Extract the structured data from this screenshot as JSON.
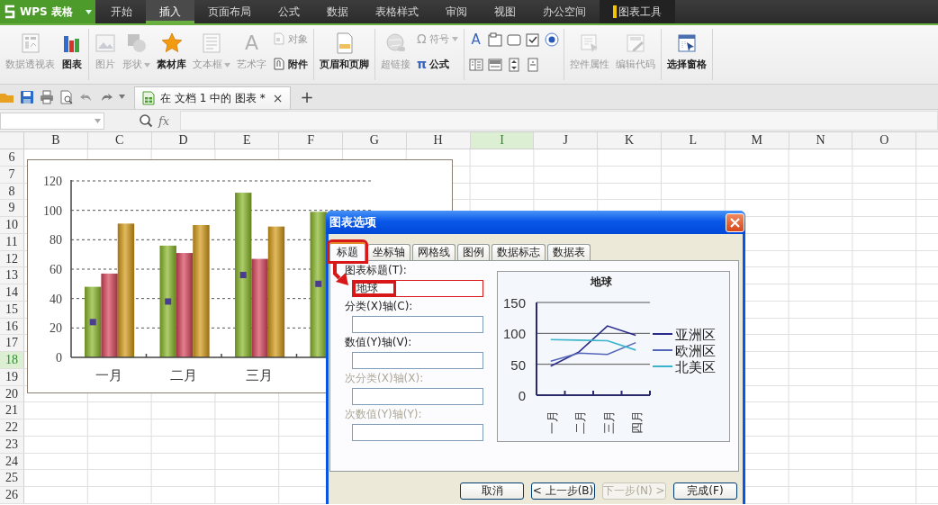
{
  "app_menu": {
    "label": "WPS 表格"
  },
  "menu_tabs": [
    {
      "label": "开始",
      "selected": false,
      "kind": "normal"
    },
    {
      "label": "插入",
      "selected": true,
      "kind": "normal"
    },
    {
      "label": "页面布局",
      "selected": false,
      "kind": "normal"
    },
    {
      "label": "公式",
      "selected": false,
      "kind": "normal"
    },
    {
      "label": "数据",
      "selected": false,
      "kind": "normal"
    },
    {
      "label": "表格样式",
      "selected": false,
      "kind": "normal"
    },
    {
      "label": "审阅",
      "selected": false,
      "kind": "normal"
    },
    {
      "label": "视图",
      "selected": false,
      "kind": "normal"
    },
    {
      "label": "办公空间",
      "selected": false,
      "kind": "normal"
    },
    {
      "label": "图表工具",
      "selected": false,
      "kind": "context"
    }
  ],
  "ribbon": {
    "groups": [
      {
        "items": [
          {
            "kind": "large",
            "label": "数据透视表",
            "disabled": true
          },
          {
            "kind": "large",
            "label": "图表",
            "disabled": false
          }
        ]
      },
      {
        "items": [
          {
            "kind": "large",
            "label": "图片",
            "disabled": true
          },
          {
            "kind": "large",
            "label": "形状",
            "disabled": true,
            "dropdown": true
          },
          {
            "kind": "large",
            "label": "素材库",
            "disabled": false
          },
          {
            "kind": "large",
            "label": "文本框",
            "disabled": true,
            "dropdown": true
          },
          {
            "kind": "large",
            "label": "艺术字",
            "disabled": true,
            "glyph": "A"
          },
          {
            "kind": "stack",
            "items": [
              {
                "label": "对象",
                "disabled": true
              },
              {
                "label": "附件",
                "disabled": false
              }
            ]
          }
        ]
      },
      {
        "items": [
          {
            "kind": "large",
            "label": "页眉和页脚",
            "disabled": false
          }
        ]
      },
      {
        "items": [
          {
            "kind": "large",
            "label": "超链接",
            "disabled": true
          },
          {
            "kind": "stack",
            "items": [
              {
                "label": "符号",
                "disabled": true,
                "glyph": "Ω",
                "dropdown": true
              },
              {
                "label": "公式",
                "disabled": false,
                "glyph": "π"
              }
            ]
          }
        ]
      },
      {
        "items": [
          {
            "kind": "controls",
            "glyph": "A"
          }
        ]
      },
      {
        "items": [
          {
            "kind": "large",
            "label": "控件属性",
            "disabled": true
          },
          {
            "kind": "large",
            "label": "编辑代码",
            "disabled": true
          }
        ]
      },
      {
        "items": [
          {
            "kind": "large",
            "label": "选择窗格",
            "disabled": false
          }
        ]
      }
    ]
  },
  "quick_access": {
    "document_tab": {
      "label": "在 文档 1 中的 图表 *",
      "close": "×"
    },
    "new_tab": "+"
  },
  "formula_bar": {
    "function_button": "fx"
  },
  "sheet": {
    "columns": [
      {
        "label": "B",
        "selected": false
      },
      {
        "label": "C",
        "selected": false
      },
      {
        "label": "D",
        "selected": false
      },
      {
        "label": "E",
        "selected": false
      },
      {
        "label": "F",
        "selected": false
      },
      {
        "label": "G",
        "selected": false
      },
      {
        "label": "H",
        "selected": false
      },
      {
        "label": "I",
        "selected": true
      },
      {
        "label": "J",
        "selected": false
      },
      {
        "label": "K",
        "selected": false
      },
      {
        "label": "L",
        "selected": false
      },
      {
        "label": "M",
        "selected": false
      },
      {
        "label": "N",
        "selected": false
      },
      {
        "label": "O",
        "selected": false
      }
    ],
    "rows": [
      {
        "label": "6",
        "selected": false
      },
      {
        "label": "7",
        "selected": false
      },
      {
        "label": "8",
        "selected": false
      },
      {
        "label": "9",
        "selected": false
      },
      {
        "label": "10",
        "selected": false
      },
      {
        "label": "11",
        "selected": false
      },
      {
        "label": "12",
        "selected": false
      },
      {
        "label": "13",
        "selected": false
      },
      {
        "label": "14",
        "selected": false
      },
      {
        "label": "15",
        "selected": false
      },
      {
        "label": "16",
        "selected": false
      },
      {
        "label": "17",
        "selected": false
      },
      {
        "label": "18",
        "selected": true
      },
      {
        "label": "19",
        "selected": false
      },
      {
        "label": "20",
        "selected": false
      },
      {
        "label": "21",
        "selected": false
      },
      {
        "label": "22",
        "selected": false
      },
      {
        "label": "23",
        "selected": false
      },
      {
        "label": "24",
        "selected": false
      },
      {
        "label": "25",
        "selected": false
      },
      {
        "label": "26",
        "selected": false
      }
    ]
  },
  "chart": {
    "chart_data": {
      "type": "bar",
      "grid": true,
      "categories": [
        "一月",
        "二月",
        "三月",
        null
      ],
      "ylim": [
        0,
        120
      ],
      "yticks": [
        0,
        20,
        40,
        60,
        80,
        100,
        120
      ],
      "series": [
        {
          "color": "#8ab92a",
          "values": [
            48,
            76,
            112,
            99
          ]
        },
        {
          "color": "#d9475c",
          "values": [
            57,
            71,
            67,
            null
          ]
        },
        {
          "color": "#d69c18",
          "values": [
            91,
            90,
            89,
            null
          ]
        },
        {
          "color": "#4a3c8e",
          "values": [
            24,
            38,
            56,
            50
          ],
          "type": "scatter"
        }
      ]
    }
  },
  "dialog": {
    "title": "图表选项",
    "tabs": [
      {
        "label": "标题",
        "selected": true,
        "annotated": true
      },
      {
        "label": "坐标轴",
        "selected": false,
        "annotated": false
      },
      {
        "label": "网格线",
        "selected": false,
        "annotated": false
      },
      {
        "label": "图例",
        "selected": false,
        "annotated": false
      },
      {
        "label": "数据标志",
        "selected": false,
        "annotated": false
      },
      {
        "label": "数据表",
        "selected": false,
        "annotated": false
      }
    ],
    "fields": [
      {
        "label": "图表标题(T):",
        "value": "地球",
        "disabled": false,
        "annotated": true
      },
      {
        "label": "分类(X)轴(C):",
        "disabled": false,
        "annotated": false
      },
      {
        "label": "数值(Y)轴(V):",
        "disabled": false,
        "annotated": false
      },
      {
        "label": "次分类(X)轴(X):",
        "disabled": true,
        "annotated": false
      },
      {
        "label": "次数值(Y)轴(Y):",
        "disabled": true,
        "annotated": false
      }
    ],
    "preview": {
      "chart_data": {
        "type": "line",
        "title": "地球",
        "legend": true,
        "grid": true,
        "categories": [
          "一月",
          "二月",
          "三月",
          "四月"
        ],
        "ylim": [
          0,
          150
        ],
        "yticks": [
          0,
          50,
          100,
          150
        ],
        "series": [
          {
            "name": "亚洲区",
            "color": "#2a2a8a",
            "values": [
              47,
              70,
              112,
              97
            ]
          },
          {
            "name": "欧洲区",
            "color": "#5466b8",
            "values": [
              55,
              68,
              66,
              85
            ]
          },
          {
            "name": "北美区",
            "color": "#3ab4cc",
            "values": [
              90,
              89,
              88,
              73
            ]
          }
        ]
      }
    },
    "buttons": [
      {
        "label": "取消",
        "disabled": false
      },
      {
        "label": "< 上一步(B)",
        "disabled": false
      },
      {
        "label": "下一步(N) >",
        "disabled": true
      },
      {
        "label": "完成(F)",
        "disabled": false
      }
    ]
  }
}
